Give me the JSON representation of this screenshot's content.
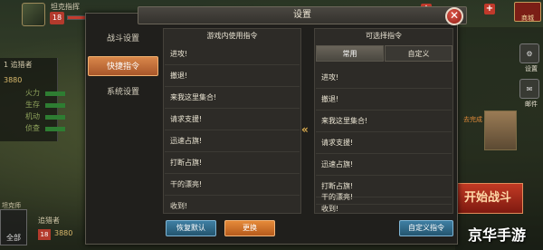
{
  "hud": {
    "player_name": "坦克指挥",
    "level": "18",
    "exp_fraction": 0.5,
    "mall_label": "商城",
    "side_rank": "1  追猎者",
    "side_power": "3880",
    "stat_labels": [
      "火力",
      "生存",
      "机动",
      "侦查"
    ],
    "teammate_label": "坦克师",
    "all_label": "全部",
    "teammate_name": "追猎者",
    "teammate_level": "18",
    "teammate_power": "3880",
    "start_battle": "开始战斗",
    "right_status": "去完成",
    "right_icon_labels": [
      "设置",
      "邮件"
    ]
  },
  "dialog": {
    "title": "设置",
    "categories": [
      {
        "label": "战斗设置",
        "active": false
      },
      {
        "label": "快捷指令",
        "active": true
      },
      {
        "label": "系统设置",
        "active": false
      }
    ],
    "left_list": {
      "header": "游戏内使用指令",
      "items": [
        "进攻!",
        "撤退!",
        "来我这里集合!",
        "请求支援!",
        "迅速占旗!",
        "打断占旗!",
        "干的漂亮!",
        "收到!"
      ]
    },
    "right_list": {
      "header": "可选择指令",
      "tabs": [
        {
          "label": "常用",
          "active": true
        },
        {
          "label": "自定义",
          "active": false
        }
      ],
      "items": [
        "进攻!",
        "撤退!",
        "来我这里集合!",
        "请求支援!",
        "迅速占旗!",
        "打断占旗!",
        "干的漂亮!",
        "收到!"
      ]
    },
    "buttons": {
      "restore": "恢复默认",
      "swap": "更换",
      "custom": "自定义指令"
    },
    "transfer_icon": "double-chevron-left-icon",
    "close_icon": "close-icon"
  },
  "watermark": "京华手游",
  "colors": {
    "accent_orange": "#d9874a",
    "button_blue": "#3f7fa3",
    "close_red": "#c0392b"
  }
}
